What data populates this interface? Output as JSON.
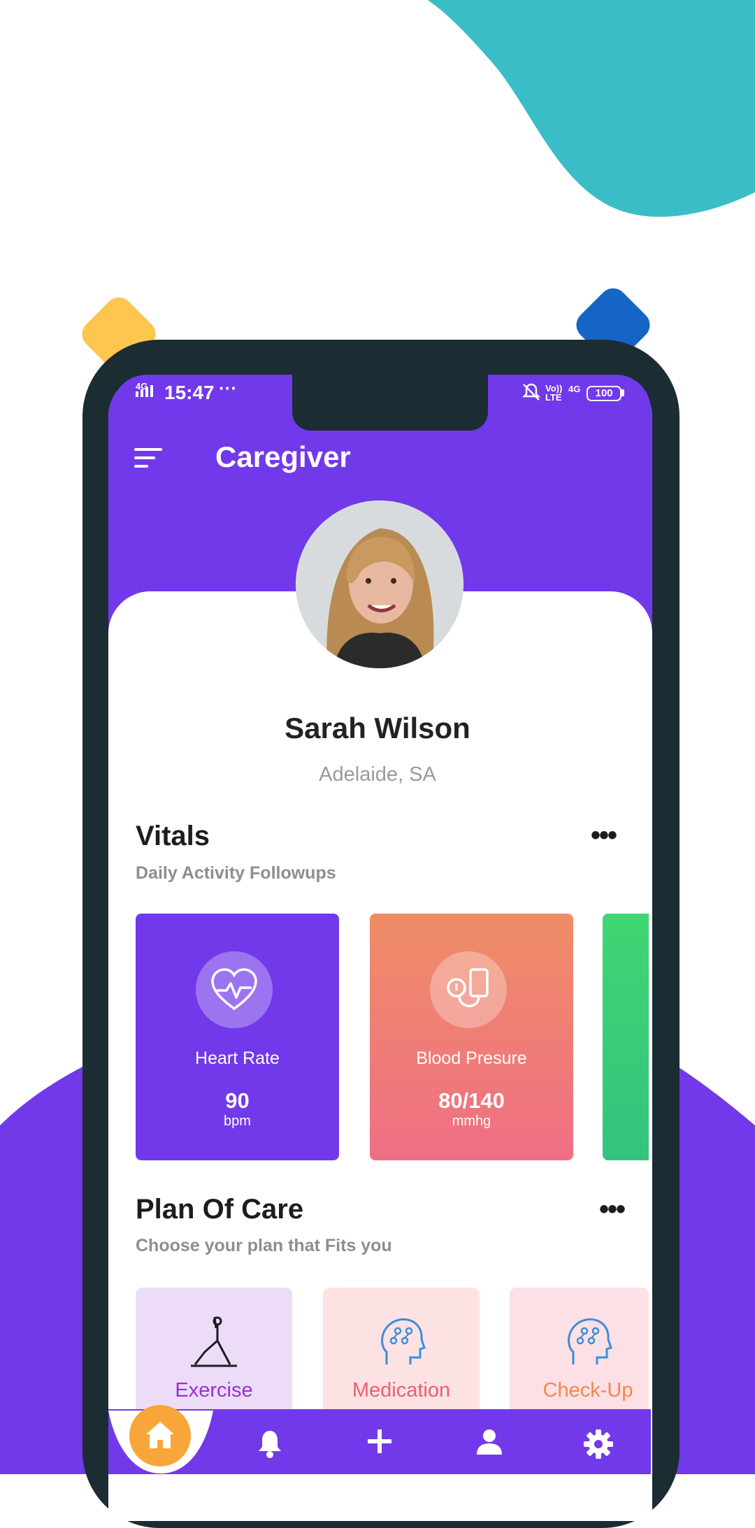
{
  "status_bar": {
    "network_left": "4G",
    "time": "15:47",
    "more": "···",
    "volte": "Vo)) LTE",
    "network_right": "4G",
    "battery": "100"
  },
  "header": {
    "title": "Caregiver",
    "menu_icon": "menu-icon"
  },
  "profile": {
    "name": "Sarah Wilson",
    "location": "Adelaide, SA"
  },
  "vitals": {
    "title": "Vitals",
    "subtitle": "Daily Activity Followups",
    "more": "•••",
    "cards": [
      {
        "label": "Heart Rate",
        "value": "90",
        "unit": "bpm",
        "icon": "heart-pulse-icon",
        "color": "#7239ea"
      },
      {
        "label": "Blood Presure",
        "value": "80/140",
        "unit": "mmhg",
        "icon": "blood-pressure-icon",
        "color": "#ef7a78"
      }
    ]
  },
  "plan_of_care": {
    "title": "Plan Of Care",
    "subtitle": "Choose your plan that Fits you",
    "more": "•••",
    "items": [
      {
        "label": "Exercise",
        "icon": "yoga-icon",
        "color": "#9a2fd1"
      },
      {
        "label": "Medication",
        "icon": "brain-icon",
        "color": "#e8616f"
      },
      {
        "label": "Check-Up",
        "icon": "brain-icon",
        "color": "#f0894a"
      }
    ]
  },
  "bottom_nav": {
    "items": [
      "home-icon",
      "bell-icon",
      "plus-icon",
      "user-icon",
      "gear-icon"
    ],
    "active": "home-icon"
  },
  "colors": {
    "primary": "#7239ea",
    "accent_orange": "#f8a63a",
    "teal": "#3bbdc8",
    "frame": "#1b2c33"
  }
}
